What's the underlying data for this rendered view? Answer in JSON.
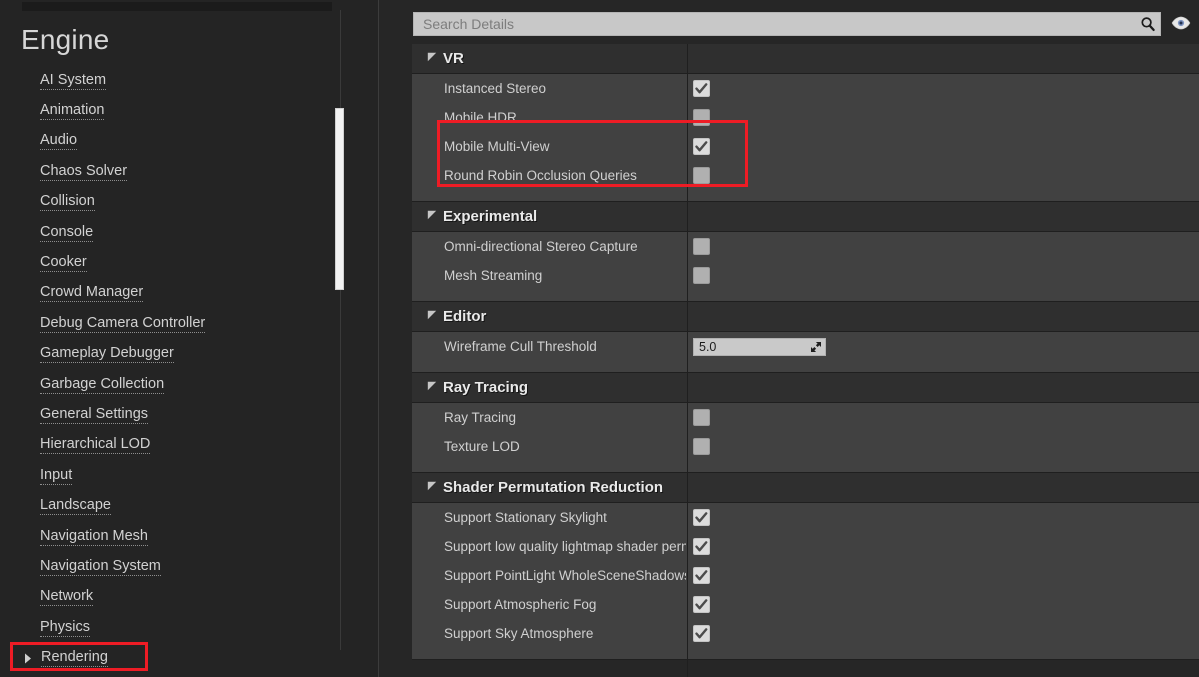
{
  "sidebar": {
    "title": "Engine",
    "items": [
      {
        "label": "AI System",
        "expandable": false,
        "highlighted": false
      },
      {
        "label": "Animation",
        "expandable": false,
        "highlighted": false
      },
      {
        "label": "Audio",
        "expandable": false,
        "highlighted": false
      },
      {
        "label": "Chaos Solver",
        "expandable": false,
        "highlighted": false
      },
      {
        "label": "Collision",
        "expandable": false,
        "highlighted": false
      },
      {
        "label": "Console",
        "expandable": false,
        "highlighted": false
      },
      {
        "label": "Cooker",
        "expandable": false,
        "highlighted": false
      },
      {
        "label": "Crowd Manager",
        "expandable": false,
        "highlighted": false
      },
      {
        "label": "Debug Camera Controller",
        "expandable": false,
        "highlighted": false
      },
      {
        "label": "Gameplay Debugger",
        "expandable": false,
        "highlighted": false
      },
      {
        "label": "Garbage Collection",
        "expandable": false,
        "highlighted": false
      },
      {
        "label": "General Settings",
        "expandable": false,
        "highlighted": false
      },
      {
        "label": "Hierarchical LOD",
        "expandable": false,
        "highlighted": false
      },
      {
        "label": "Input",
        "expandable": false,
        "highlighted": false
      },
      {
        "label": "Landscape",
        "expandable": false,
        "highlighted": false
      },
      {
        "label": "Navigation Mesh",
        "expandable": false,
        "highlighted": false
      },
      {
        "label": "Navigation System",
        "expandable": false,
        "highlighted": false
      },
      {
        "label": "Network",
        "expandable": false,
        "highlighted": false
      },
      {
        "label": "Physics",
        "expandable": false,
        "highlighted": false
      },
      {
        "label": "Rendering",
        "expandable": true,
        "highlighted": true
      }
    ]
  },
  "details": {
    "search": {
      "placeholder": "Search Details",
      "value": "",
      "search_icon": "magnifier-icon",
      "visibility_icon": "eye-icon"
    },
    "sections": [
      {
        "title": "VR",
        "expanded": true,
        "rows": [
          {
            "label": "Instanced Stereo",
            "type": "checkbox",
            "checked": true
          },
          {
            "label": "Mobile HDR",
            "type": "checkbox",
            "checked": false
          },
          {
            "label": "Mobile Multi-View",
            "type": "checkbox",
            "checked": true
          },
          {
            "label": "Round Robin Occlusion Queries",
            "type": "checkbox",
            "checked": false
          }
        ]
      },
      {
        "title": "Experimental",
        "expanded": true,
        "rows": [
          {
            "label": "Omni-directional Stereo Capture",
            "type": "checkbox",
            "checked": false
          },
          {
            "label": "Mesh Streaming",
            "type": "checkbox",
            "checked": false
          }
        ]
      },
      {
        "title": "Editor",
        "expanded": true,
        "rows": [
          {
            "label": "Wireframe Cull Threshold",
            "type": "number",
            "value": "5.0"
          }
        ]
      },
      {
        "title": "Ray Tracing",
        "expanded": true,
        "rows": [
          {
            "label": "Ray Tracing",
            "type": "checkbox",
            "checked": false
          },
          {
            "label": "Texture LOD",
            "type": "checkbox",
            "checked": false
          }
        ]
      },
      {
        "title": "Shader Permutation Reduction",
        "expanded": true,
        "rows": [
          {
            "label": "Support Stationary Skylight",
            "type": "checkbox",
            "checked": true
          },
          {
            "label": "Support low quality lightmap shader permutations",
            "type": "checkbox",
            "checked": true
          },
          {
            "label": "Support PointLight WholeSceneShadows",
            "type": "checkbox",
            "checked": true
          },
          {
            "label": "Support Atmospheric Fog",
            "type": "checkbox",
            "checked": true
          },
          {
            "label": "Support Sky Atmosphere",
            "type": "checkbox",
            "checked": true
          }
        ]
      }
    ]
  },
  "annotations": {
    "accent_color": "#ee1c25",
    "boxes": [
      {
        "target": "vr-first-three-properties"
      },
      {
        "target": "sidebar-item-rendering"
      }
    ]
  }
}
